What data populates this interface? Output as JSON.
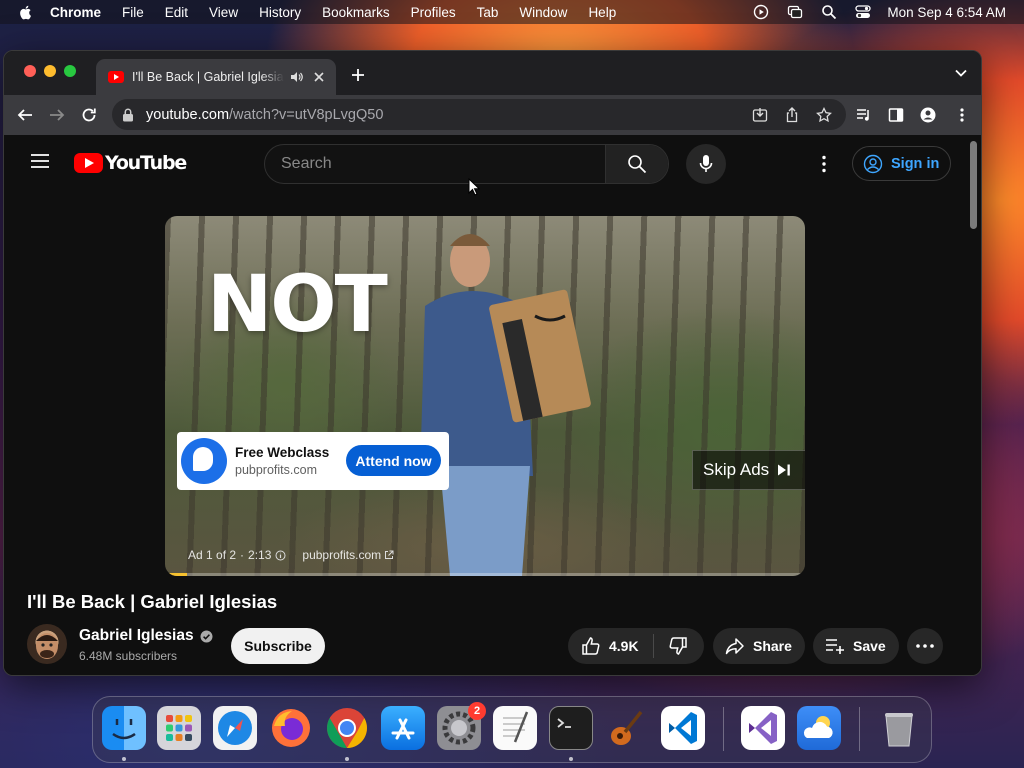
{
  "menubar": {
    "app_name": "Chrome",
    "items": [
      "File",
      "Edit",
      "View",
      "History",
      "Bookmarks",
      "Profiles",
      "Tab",
      "Window",
      "Help"
    ],
    "clock": "Mon Sep 4  6:54 AM"
  },
  "browser": {
    "tab_title": "I'll Be Back | Gabriel Iglesias",
    "url_host": "youtube.com",
    "url_path": "/watch?v=utV8pLvgQ50"
  },
  "youtube": {
    "logo_text": "YouTube",
    "search_placeholder": "Search",
    "sign_in_label": "Sign in",
    "ad": {
      "overlay_text": "NOT",
      "card_title": "Free Webclass",
      "card_domain": "pubprofits.com",
      "card_button": "Attend now",
      "skip_label": "Skip Ads",
      "info_position": "Ad 1 of 2",
      "info_time": "2:13",
      "info_domain": "pubprofits.com",
      "progress_fraction": 0.035
    },
    "video_title": "I'll Be Back | Gabriel Iglesias",
    "channel_name": "Gabriel Iglesias",
    "subscribers": "6.48M subscribers",
    "subscribe_label": "Subscribe",
    "like_count": "4.9K",
    "share_label": "Share",
    "save_label": "Save"
  },
  "dock": {
    "apps": [
      "Finder",
      "Launchpad",
      "Safari",
      "Firefox",
      "Chrome",
      "App Store",
      "System Settings",
      "TextEdit",
      "Terminal",
      "GarageBand",
      "Visual Studio Code",
      "Visual Studio",
      "Weather",
      "Trash"
    ],
    "settings_badge": "2"
  },
  "colors": {
    "youtube_red": "#ff0000",
    "link_blue": "#3ea6ff",
    "ad_button_blue": "#065fd4",
    "ad_progress": "#f6c12f"
  }
}
